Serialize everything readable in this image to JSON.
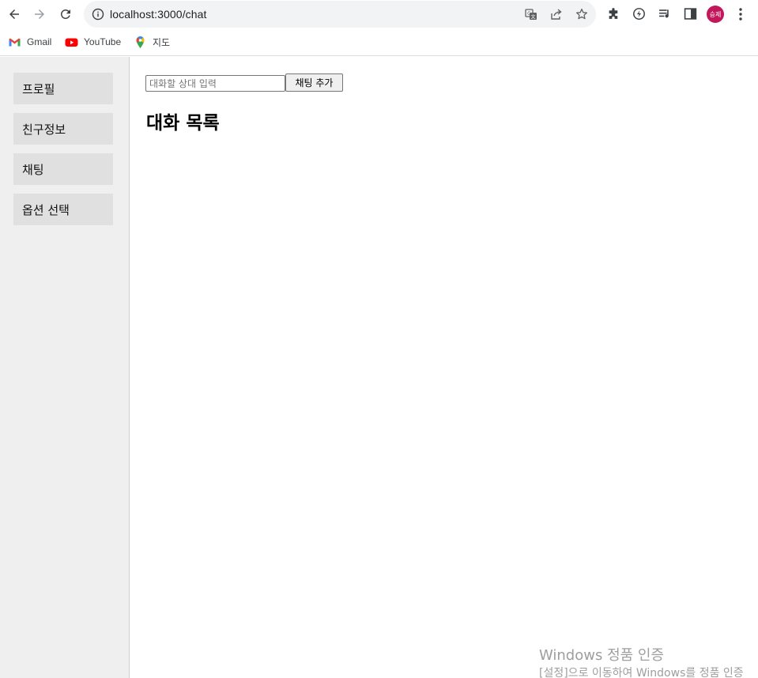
{
  "browser": {
    "url": "localhost:3000/chat",
    "profile_initials": "승제",
    "icons": {
      "back": "arrow-left-icon",
      "forward": "arrow-right-icon",
      "reload": "reload-icon",
      "site_info": "info-icon",
      "translate": "translate-icon",
      "share": "share-icon",
      "bookmark": "star-icon",
      "extensions": "puzzle-icon",
      "performance": "lightning-icon",
      "media": "music-queue-icon",
      "side_panel": "side-panel-icon",
      "menu": "kebab-menu-icon"
    }
  },
  "bookmarks": [
    {
      "label": "Gmail",
      "icon": "gmail-icon"
    },
    {
      "label": "YouTube",
      "icon": "youtube-icon"
    },
    {
      "label": "지도",
      "icon": "maps-pin-icon"
    }
  ],
  "sidebar": {
    "items": [
      {
        "label": "프로필"
      },
      {
        "label": "친구정보"
      },
      {
        "label": "채팅"
      },
      {
        "label": "옵션 선택"
      }
    ]
  },
  "chat": {
    "input_placeholder": "대화할 상대 입력",
    "input_value": "",
    "add_button": "채팅 추가",
    "list_title": "대화 목록"
  },
  "watermark": {
    "title": "Windows 정품 인증",
    "subtitle": "[설정]으로 이동하여 Windows를 정품 인증"
  },
  "colors": {
    "sidebar_bg": "#efefef",
    "sidebar_item_bg": "#e0e0e0",
    "avatar_bg": "#c2185b"
  }
}
